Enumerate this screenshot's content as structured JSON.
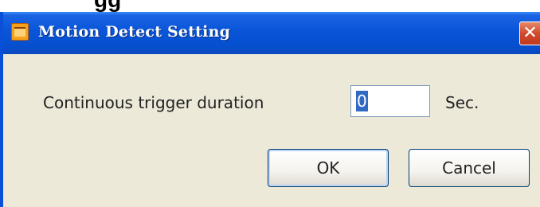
{
  "background_title": "...gg...",
  "window": {
    "title": "Motion Detect Setting",
    "close_glyph": "✕",
    "title_bar_color": "#0a54d8",
    "face_color": "#ece9d8"
  },
  "form": {
    "duration_label": "Continuous trigger duration",
    "duration_value": "0",
    "unit_label": "Sec."
  },
  "buttons": {
    "ok_label": "OK",
    "cancel_label": "Cancel"
  },
  "icons": {
    "app": "app-icon",
    "close": "close-icon"
  }
}
